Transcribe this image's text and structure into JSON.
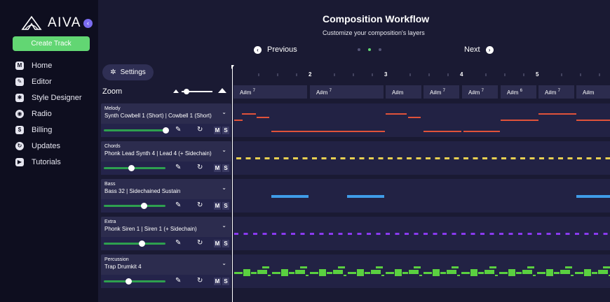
{
  "app": {
    "name": "AIVA",
    "collapse_icon": "chevron-left-icon"
  },
  "sidebar": {
    "create_label": "Create Track",
    "items": [
      {
        "label": "Home",
        "icon": "home-icon",
        "glyph": "M"
      },
      {
        "label": "Editor",
        "icon": "pencil-icon",
        "glyph": "✎"
      },
      {
        "label": "Style Designer",
        "icon": "style-icon",
        "glyph": "✱"
      },
      {
        "label": "Radio",
        "icon": "radio-icon",
        "glyph": "◉"
      },
      {
        "label": "Billing",
        "icon": "dollar-icon",
        "glyph": "$"
      },
      {
        "label": "Updates",
        "icon": "updates-icon",
        "glyph": "↻"
      },
      {
        "label": "Tutorials",
        "icon": "play-icon",
        "glyph": "▶"
      }
    ]
  },
  "header": {
    "title": "Composition Workflow",
    "subtitle": "Customize your composition's layers",
    "prev_label": "Previous",
    "next_label": "Next",
    "step_count": 3,
    "active_step": 2
  },
  "controls": {
    "settings_label": "Settings",
    "zoom_label": "Zoom",
    "zoom_level": 0.15
  },
  "timeline": {
    "bars": [
      "2",
      "3",
      "4",
      "5"
    ],
    "chords": [
      "A#m",
      "A#m",
      "A#m",
      "A#m",
      "A#m",
      "A#m",
      "A#m",
      "A#m"
    ],
    "chord_sups": [
      "7",
      "7",
      "",
      "7",
      "7",
      "6",
      "7",
      ""
    ]
  },
  "tracks": [
    {
      "type": "Melody",
      "instrument": "Synth Cowbell 1 (Short) | Cowbell 1 (Short)",
      "volume": 1.0,
      "color": "#e0523a"
    },
    {
      "type": "Chords",
      "instrument": "Phonk Lead Synth 4 | Lead 4 (+ Sidechain)",
      "volume": 0.45,
      "color": "#e8d050"
    },
    {
      "type": "Bass",
      "instrument": "Bass 32 | Sidechained Sustain",
      "volume": 0.65,
      "color": "#3f9ce8"
    },
    {
      "type": "Extra",
      "instrument": "Phonk Siren 1 | Siren 1 (+ Sidechain)",
      "volume": 0.62,
      "color": "#8a3af0"
    },
    {
      "type": "Percussion",
      "instrument": "Trap Drumkit 4",
      "volume": 0.4,
      "color": "#5ad040"
    }
  ],
  "track_buttons": {
    "mute": "M",
    "solo": "S"
  }
}
